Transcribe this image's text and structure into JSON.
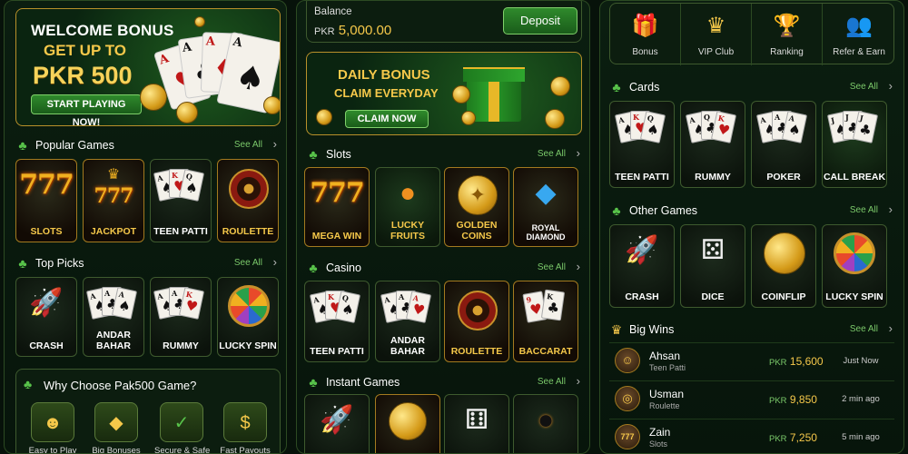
{
  "left": {
    "hero": {
      "line1": "WELCOME BONUS",
      "line2": "GET UP TO",
      "line3": "PKR 500",
      "cta": "START PLAYING NOW!"
    },
    "popular": {
      "title": "Popular Games",
      "see_all": "See All",
      "games": [
        "SLOTS",
        "JACKPOT",
        "TEEN PATTI",
        "ROULETTE"
      ]
    },
    "top_picks": {
      "title": "Top Picks",
      "see_all": "See All",
      "games": [
        "CRASH",
        "ANDAR BAHAR",
        "RUMMY",
        "LUCKY SPIN"
      ]
    },
    "why": {
      "title": "Why Choose Pak500 Game?",
      "items": [
        "Easy to Play",
        "Big Bonuses",
        "Secure & Safe",
        "Fast Payouts"
      ]
    }
  },
  "middle": {
    "balance": {
      "label": "Balance",
      "currency": "PKR",
      "amount": "5,000.00",
      "deposit": "Deposit"
    },
    "daily": {
      "line1": "DAILY BONUS",
      "line2": "CLAIM EVERYDAY",
      "cta": "CLAIM NOW"
    },
    "slots": {
      "title": "Slots",
      "see_all": "See All",
      "games": [
        "MEGA WIN",
        "LUCKY FRUITS",
        "GOLDEN COINS",
        "ROYAL DIAMOND"
      ]
    },
    "casino": {
      "title": "Casino",
      "see_all": "See All",
      "games": [
        "TEEN PATTI",
        "ANDAR BAHAR",
        "ROULETTE",
        "BACCARAT"
      ]
    },
    "instant": {
      "title": "Instant Games",
      "see_all": "See All"
    }
  },
  "right": {
    "nav": [
      "Bonus",
      "VIP Club",
      "Ranking",
      "Refer & Earn"
    ],
    "cards": {
      "title": "Cards",
      "see_all": "See All",
      "games": [
        "TEEN PATTI",
        "RUMMY",
        "POKER",
        "CALL BREAK"
      ]
    },
    "other": {
      "title": "Other Games",
      "see_all": "See All",
      "games": [
        "CRASH",
        "DICE",
        "COINFLIP",
        "LUCKY SPIN"
      ]
    },
    "big_wins": {
      "title": "Big Wins",
      "see_all": "See All",
      "rows": [
        {
          "name": "Ahsan",
          "game": "Teen Patti",
          "currency": "PKR",
          "amount": "15,600",
          "time": "Just Now"
        },
        {
          "name": "Usman",
          "game": "Roulette",
          "currency": "PKR",
          "amount": "9,850",
          "time": "2 min ago"
        },
        {
          "name": "Zain",
          "game": "Slots",
          "currency": "PKR",
          "amount": "7,250",
          "time": "5 min ago"
        }
      ]
    }
  },
  "colors": {
    "gold": "#f5c84a",
    "green_accent": "#58c34a",
    "tile_border": "#a37a1f"
  }
}
